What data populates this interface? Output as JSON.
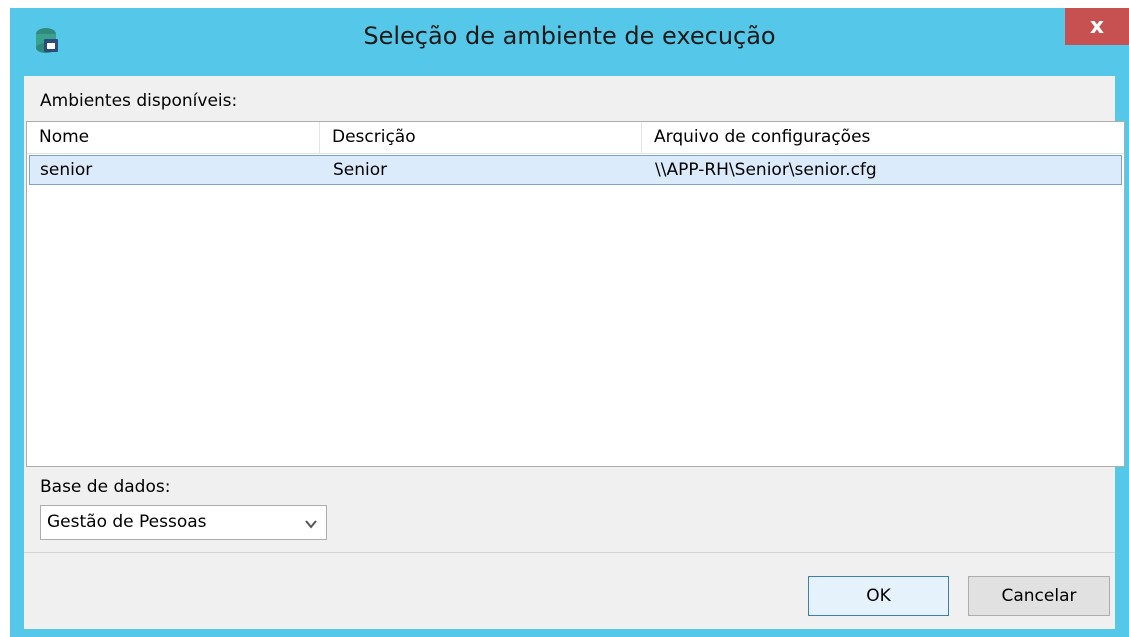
{
  "window": {
    "title": "Seleção de ambiente de execução",
    "close_label": "x"
  },
  "environments": {
    "label": "Ambientes disponíveis:",
    "columns": [
      "Nome",
      "Descrição",
      "Arquivo de configurações"
    ],
    "rows": [
      {
        "nome": "senior",
        "descricao": "Senior",
        "arquivo": "\\\\APP-RH\\Senior\\senior.cfg"
      }
    ]
  },
  "database": {
    "label": "Base de dados:",
    "selected": "Gestão de Pessoas"
  },
  "buttons": {
    "ok": "OK",
    "cancel": "Cancelar"
  },
  "colors": {
    "frame": "#55c7e9",
    "close": "#c75050",
    "selected_row": "#dcebfc"
  },
  "icons": {
    "app": "database-app-icon",
    "dropdown": "chevron-down-icon"
  }
}
